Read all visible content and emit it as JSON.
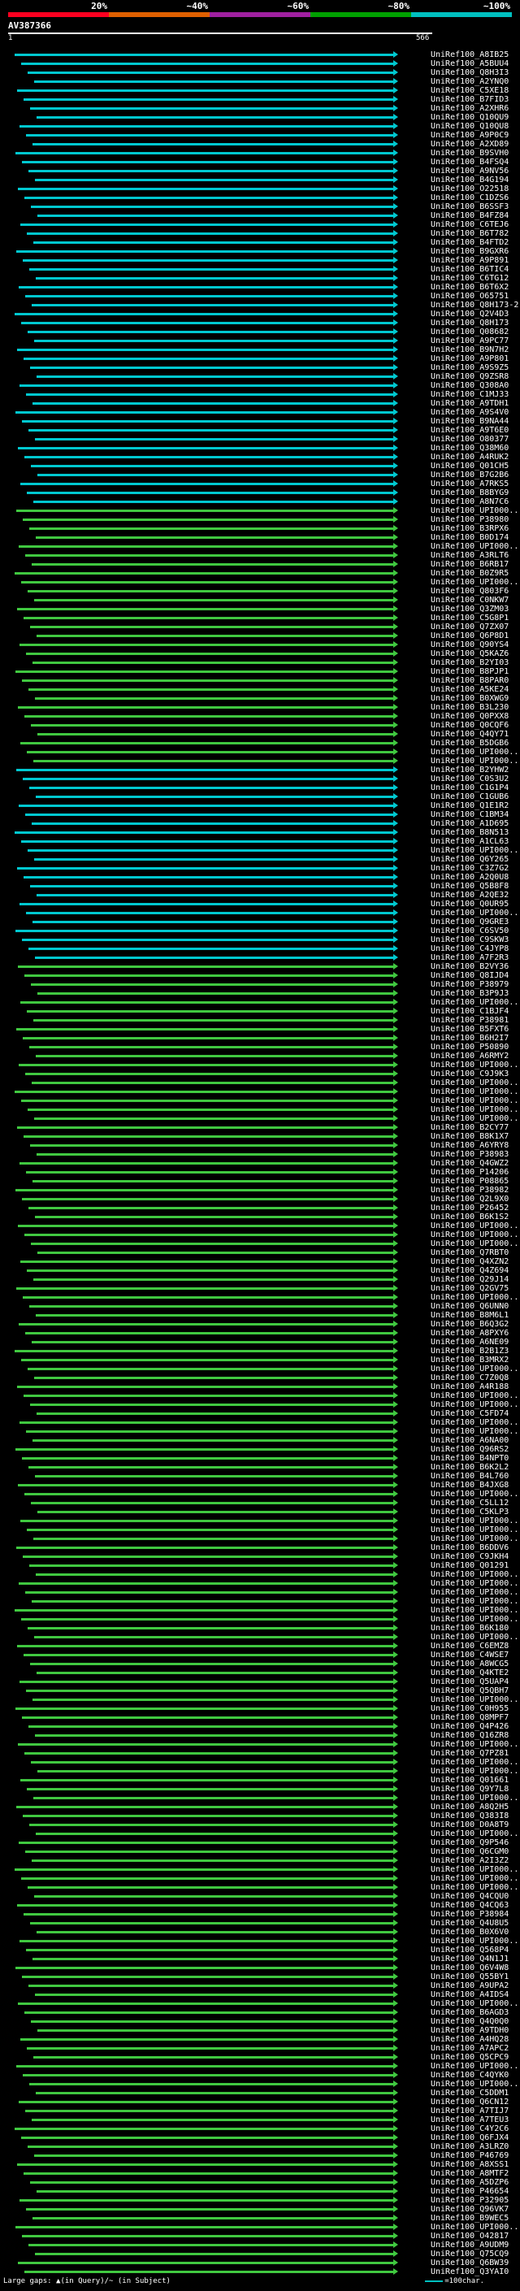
{
  "header": {
    "coverage_labels": [
      "20%",
      "~40%",
      "~60%",
      "~80%",
      "~100%"
    ],
    "coverage_colors": [
      "#ff0020",
      "#e06000",
      "#a020a0",
      "#00a000",
      "#00c0c0"
    ],
    "query_id": "AV387366",
    "ruler_start": "1",
    "ruler_end": "566"
  },
  "hit_colors": {
    "cyan": "#00c8d0",
    "green": "#40c840"
  },
  "cyan_index_ranges": [
    [
      0,
      50
    ],
    [
      80,
      101
    ]
  ],
  "hits": [
    "UniRef100_A8IB25",
    "UniRef100_A5BUU4",
    "UniRef100_Q8H3I3",
    "UniRef100_A2YNQ0",
    "UniRef100_C5XE18",
    "UniRef100_B7FID3",
    "UniRef100_A2XHR6",
    "UniRef100_Q10QU9",
    "UniRef100_Q10QU8",
    "UniRef100_A9P0C9",
    "UniRef100_A2XD89",
    "UniRef100_B9SVH0",
    "UniRef100_B4FSQ4",
    "UniRef100_A9NV56",
    "UniRef100_B4G194",
    "UniRef100_O22518",
    "UniRef100_C1DZS6",
    "UniRef100_B6SSF3",
    "UniRef100_B4FZ84",
    "UniRef100_C6TEJ6",
    "UniRef100_B6T782",
    "UniRef100_B4FTD2",
    "UniRef100_B9GXR6",
    "UniRef100_A9P891",
    "UniRef100_B6TIC4",
    "UniRef100_C6TG12",
    "UniRef100_B6T6X2",
    "UniRef100_O65751",
    "UniRef100_Q8H173-2",
    "UniRef100_Q2V4D3",
    "UniRef100_Q8H173",
    "UniRef100_Q08682",
    "UniRef100_A9PC77",
    "UniRef100_B9N7H2",
    "UniRef100_A9P801",
    "UniRef100_A9S9Z5",
    "UniRef100_Q9ZSR8",
    "UniRef100_Q308A0",
    "UniRef100_C1MJ33",
    "UniRef100_A9TDH1",
    "UniRef100_A9S4V0",
    "UniRef100_B9NA44",
    "UniRef100_A9T6E0",
    "UniRef100_O80377",
    "UniRef100_Q38M60",
    "UniRef100_A4RUK2",
    "UniRef100_Q01CH5",
    "UniRef100_B7G2B6",
    "UniRef100_A7RKS5",
    "UniRef100_B8BYG9",
    "UniRef100_A8N7C6",
    "UniRef100_UPI000..",
    "UniRef100_P38980",
    "UniRef100_B3RPX6",
    "UniRef100_B0D174",
    "UniRef100_UPI000..",
    "UniRef100_A3RLT6",
    "UniRef100_B6RB17",
    "UniRef100_B0Z9R5",
    "UniRef100_UPI000..",
    "UniRef100_Q803F6",
    "UniRef100_C0NKW7",
    "UniRef100_Q3ZM03",
    "UniRef100_C5G8P1",
    "UniRef100_Q7ZX07",
    "UniRef100_Q6P8D1",
    "UniRef100_Q90YS4",
    "UniRef100_Q5KAZ6",
    "UniRef100_B2YI03",
    "UniRef100_B8PJP1",
    "UniRef100_B8PAR0",
    "UniRef100_A5KE24",
    "UniRef100_B0XWG9",
    "UniRef100_B3L230",
    "UniRef100_Q0PXX8",
    "UniRef100_Q0CQF6",
    "UniRef100_Q4QY71",
    "UniRef100_B5DGB6",
    "UniRef100_UPI000..",
    "UniRef100_UPI000..",
    "UniRef100_B2YHW2",
    "UniRef100_C0S3U2",
    "UniRef100_C1G1P4",
    "UniRef100_C1GUB6",
    "UniRef100_Q1E1R2",
    "UniRef100_C1BM34",
    "UniRef100_A1D695",
    "UniRef100_B8N513",
    "UniRef100_A1CL63",
    "UniRef100_UPI000..",
    "UniRef100_Q6Y265",
    "UniRef100_C3Z7G2",
    "UniRef100_A2Q0U8",
    "UniRef100_Q5B8F8",
    "UniRef100_A2QE32",
    "UniRef100_Q0UR95",
    "UniRef100_UPI000..",
    "UniRef100_Q9GRE3",
    "UniRef100_C6SV50",
    "UniRef100_C9SKW3",
    "UniRef100_C4JYP8",
    "UniRef100_A7F2R3",
    "UniRef100_B2VY36",
    "UniRef100_Q8IJD4",
    "UniRef100_P38979",
    "UniRef100_B3P9J3",
    "UniRef100_UPI000..",
    "UniRef100_C1BJF4",
    "UniRef100_P38981",
    "UniRef100_B5FXT6",
    "UniRef100_B6H2I7",
    "UniRef100_P50890",
    "UniRef100_A6RMY2",
    "UniRef100_UPI000..",
    "UniRef100_C9J9K3",
    "UniRef100_UPI000..",
    "UniRef100_UPI000..",
    "UniRef100_UPI000..",
    "UniRef100_UPI000..",
    "UniRef100_UPI000..",
    "UniRef100_B2CY77",
    "UniRef100_B8K1X7",
    "UniRef100_A6YRY8",
    "UniRef100_P38983",
    "UniRef100_Q4GWZ2",
    "UniRef100_P14206",
    "UniRef100_P08865",
    "UniRef100_P38982",
    "UniRef100_Q2L9X0",
    "UniRef100_P26452",
    "UniRef100_B6K1S2",
    "UniRef100_UPI000..",
    "UniRef100_UPI000..",
    "UniRef100_UPI000..",
    "UniRef100_Q7RBT0",
    "UniRef100_Q4XZN2",
    "UniRef100_Q4Z694",
    "UniRef100_Q29J14",
    "UniRef100_Q2GV75",
    "UniRef100_UPI000..",
    "UniRef100_Q6UNN0",
    "UniRef100_B8M6L1",
    "UniRef100_B6Q3G2",
    "UniRef100_A8PXY6",
    "UniRef100_A6NE09",
    "UniRef100_B2B1Z3",
    "UniRef100_B3MRX2",
    "UniRef100_UPI000..",
    "UniRef100_C7Z0Q8",
    "UniRef100_A4R188",
    "UniRef100_UPI000..",
    "UniRef100_UPI000..",
    "UniRef100_C5FD74",
    "UniRef100_UPI000..",
    "UniRef100_UPI000..",
    "UniRef100_A6NA00",
    "UniRef100_Q96RS2",
    "UniRef100_B4NPT0",
    "UniRef100_B6K2L2",
    "UniRef100_B4L760",
    "UniRef100_B4JXG8",
    "UniRef100_UPI000..",
    "UniRef100_C5LL12",
    "UniRef100_C5KLP3",
    "UniRef100_UPI000..",
    "UniRef100_UPI000..",
    "UniRef100_UPI000..",
    "UniRef100_B6DDV6",
    "UniRef100_C9JKH4",
    "UniRef100_Q01291",
    "UniRef100_UPI000..",
    "UniRef100_UPI000..",
    "UniRef100_UPI000..",
    "UniRef100_UPI000..",
    "UniRef100_UPI000..",
    "UniRef100_UPI000..",
    "UniRef100_B6K180",
    "UniRef100_UPI000..",
    "UniRef100_C6EMZ8",
    "UniRef100_C4WSE7",
    "UniRef100_A8WCG5",
    "UniRef100_Q4KTE2",
    "UniRef100_Q5UAP4",
    "UniRef100_Q5QBH7",
    "UniRef100_UPI000..",
    "UniRef100_C0H955",
    "UniRef100_Q8MPF7",
    "UniRef100_Q4P426",
    "UniRef100_Q16ZR8",
    "UniRef100_UPI000..",
    "UniRef100_Q7PZ81",
    "UniRef100_UPI000..",
    "UniRef100_UPI000..",
    "UniRef100_Q01661",
    "UniRef100_Q9Y7L8",
    "UniRef100_UPI000..",
    "UniRef100_A8Q2H5",
    "UniRef100_Q383I8",
    "UniRef100_D0A8T9",
    "UniRef100_UPI000..",
    "UniRef100_Q9P546",
    "UniRef100_Q6CGM0",
    "UniRef100_A2I3Z2",
    "UniRef100_UPI000..",
    "UniRef100_UPI000..",
    "UniRef100_UPI000..",
    "UniRef100_Q4CQU0",
    "UniRef100_Q4CQ63",
    "UniRef100_P38984",
    "UniRef100_Q4U8U5",
    "UniRef100_B0X6V0",
    "UniRef100_UPI000..",
    "UniRef100_Q568P4",
    "UniRef100_Q4N1J1",
    "UniRef100_Q6V4W8",
    "UniRef100_Q55BY1",
    "UniRef100_A9UPA2",
    "UniRef100_A4IDS4",
    "UniRef100_UPI000..",
    "UniRef100_B6AGD3",
    "UniRef100_Q4Q0Q0",
    "UniRef100_A9TDH0",
    "UniRef100_A4HQ28",
    "UniRef100_A7APC2",
    "UniRef100_Q5CPC9",
    "UniRef100_UPI000..",
    "UniRef100_C4QYK0",
    "UniRef100_UPI000..",
    "UniRef100_C5DDM1",
    "UniRef100_Q6CN12",
    "UniRef100_A7TIJ7",
    "UniRef100_A7TEU3",
    "UniRef100_C4Y2C6",
    "UniRef100_Q6FJX4",
    "UniRef100_A3LRZ0",
    "UniRef100_P46769",
    "UniRef100_A8XSS1",
    "UniRef100_A8MTF2",
    "UniRef100_A5DZP6",
    "UniRef100_P46654",
    "UniRef100_P32905",
    "UniRef100_Q96VK7",
    "UniRef100_B9WEC5",
    "UniRef100_UPI000..",
    "UniRef100_O42817",
    "UniRef100_A9UDM9",
    "UniRef100_Q75CQ9",
    "UniRef100_Q6BW39",
    "UniRef100_Q3YAI0"
  ],
  "footer": {
    "gaps_label": "Large gaps: ▲(in Query)/~ (in Subject)",
    "scale_label": "=100char."
  }
}
